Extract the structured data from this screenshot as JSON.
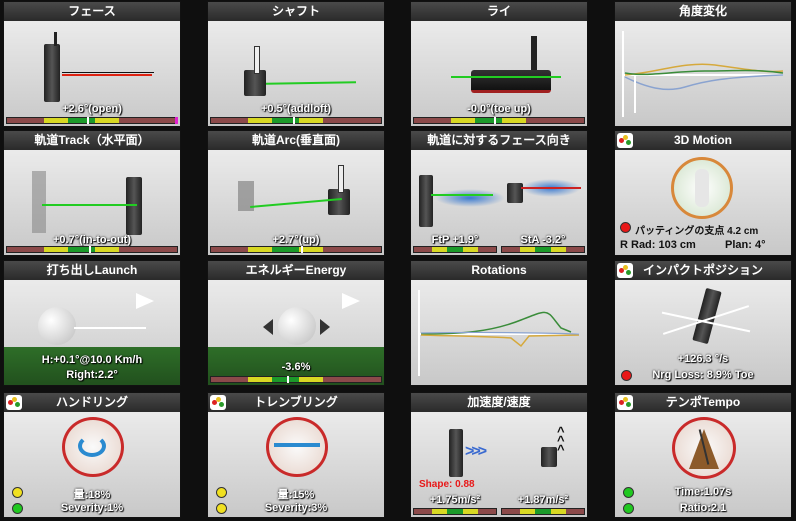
{
  "tiles": {
    "face": {
      "title": "フェース",
      "value": "+2.6°(open)"
    },
    "shaft": {
      "title": "シャフト",
      "value": "+0.5°(addloft)"
    },
    "lie": {
      "title": "ライ",
      "value": "-0.0°(toe up)"
    },
    "angle_change": {
      "title": "角度変化"
    },
    "track": {
      "title": "軌道Track（水平面）",
      "value": "+0.7°(in-to-out)"
    },
    "arc": {
      "title": "軌道Arc(垂直面)",
      "value": "+2.7°(up)"
    },
    "face_to_path": {
      "title": "軌道に対するフェース向き",
      "ftp": "FtP +1.9°",
      "sta": "StA -3.2°"
    },
    "motion3d": {
      "title": "3D Motion",
      "fulcrum": "パッティングの支点 4.2 cm",
      "rrad": "R Rad: 103 cm",
      "plan": "Plan: 4°"
    },
    "launch": {
      "title": "打ち出しLaunch",
      "line1": "H:+0.1°@10.0 Km/h",
      "line2": "Right:2.2°"
    },
    "energy": {
      "title": "エネルギーEnergy",
      "value": "-3.6%"
    },
    "rotations": {
      "title": "Rotations"
    },
    "impact": {
      "title": "インパクトポジション",
      "value": "+126.3 °/s",
      "nrg": "Nrg Loss: 8.9% Toe"
    },
    "handling": {
      "title": "ハンドリング",
      "amount": "量:18%",
      "severity": "Severity:1%"
    },
    "trembling": {
      "title": "トレンブリング",
      "amount": "量:15%",
      "severity": "Severity:3%"
    },
    "accel": {
      "title": "加速度/速度",
      "shape": "Shape: 0.88",
      "left": "+1.75m/s²",
      "right": "+1.87m/s²"
    },
    "tempo": {
      "title": "テンポTempo",
      "time": "Time:1.07s",
      "ratio": "Ratio:2.1"
    }
  },
  "colors": {
    "gauge_red": "#8c4a4a",
    "gauge_yellow": "#d8d823",
    "gauge_green": "#1c9a2a",
    "indicator_red": "#e81818",
    "indicator_yellow": "#f0e020",
    "indicator_green": "#20c820"
  }
}
